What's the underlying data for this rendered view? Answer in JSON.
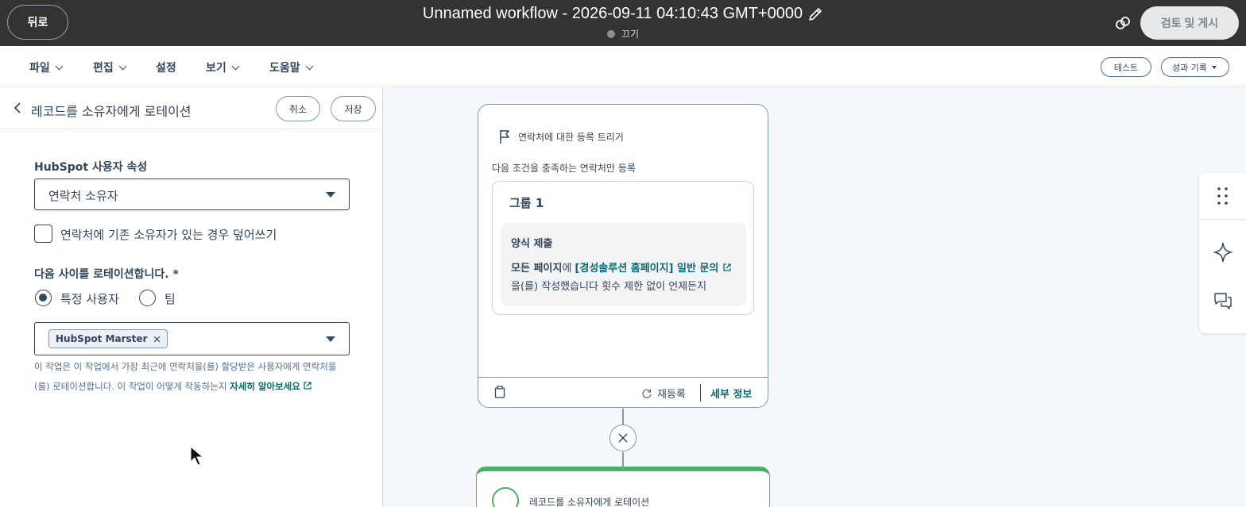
{
  "topbar": {
    "back_label": "뒤로",
    "workflow_title": "Unnamed workflow - 2026-09-11 04:10:43 GMT+0000",
    "status": "끄기",
    "review_publish_label": "검토 및 게시"
  },
  "menu": {
    "items": [
      "파일",
      "편집",
      "설정",
      "보기",
      "도움말"
    ],
    "test_label": "테스트",
    "performance_label": "성과 기록"
  },
  "panel": {
    "title": "레코드를 소유자에게 로테이션",
    "cancel_label": "취소",
    "save_label": "저장",
    "property_label": "HubSpot 사용자 속성",
    "property_value": "연락처 소유자",
    "overwrite_label": "연락처에 기존 소유자가 있는 경우 덮어쓰기",
    "overwrite_checked": false,
    "rotate_label": "다음 사이를 로테이션합니다. *",
    "radio_specific_user": "특정 사용자",
    "radio_team": "팀",
    "selected_radio": "특정 사용자",
    "selected_user_tag": "HubSpot Marster",
    "help_text": "이 작업은 이 작업에서 가장 최근에 연락처을(를) 할당받은 사용자에게 연락처을(를) 로테이션합니다. 이 작업이 어떻게 작동하는지 ",
    "help_link": "자세히 알아보세요"
  },
  "trigger_card": {
    "title": "연락처에 대한 등록 트리거",
    "condition": "다음 조건을 충족하는 연락처만 등록",
    "group_title": "그룹 1",
    "filter_title": "양식 제출",
    "filter_prefix": "모든 페이지",
    "filter_particle": "에 ",
    "filter_form_link": "[경성솔루션 홈페이지] 일반 문의",
    "filter_suffix": "을(를) 작성했습니다 횟수 제한 없이 언제든지",
    "reenroll_label": "재등록",
    "details_label": "세부 정보"
  },
  "action_card": {
    "title": "레코드를 소유자에게 로테이션"
  },
  "colors": {
    "topbar": "#333333",
    "accent_link": "#0b6b73",
    "action_green": "#4caf6a"
  }
}
